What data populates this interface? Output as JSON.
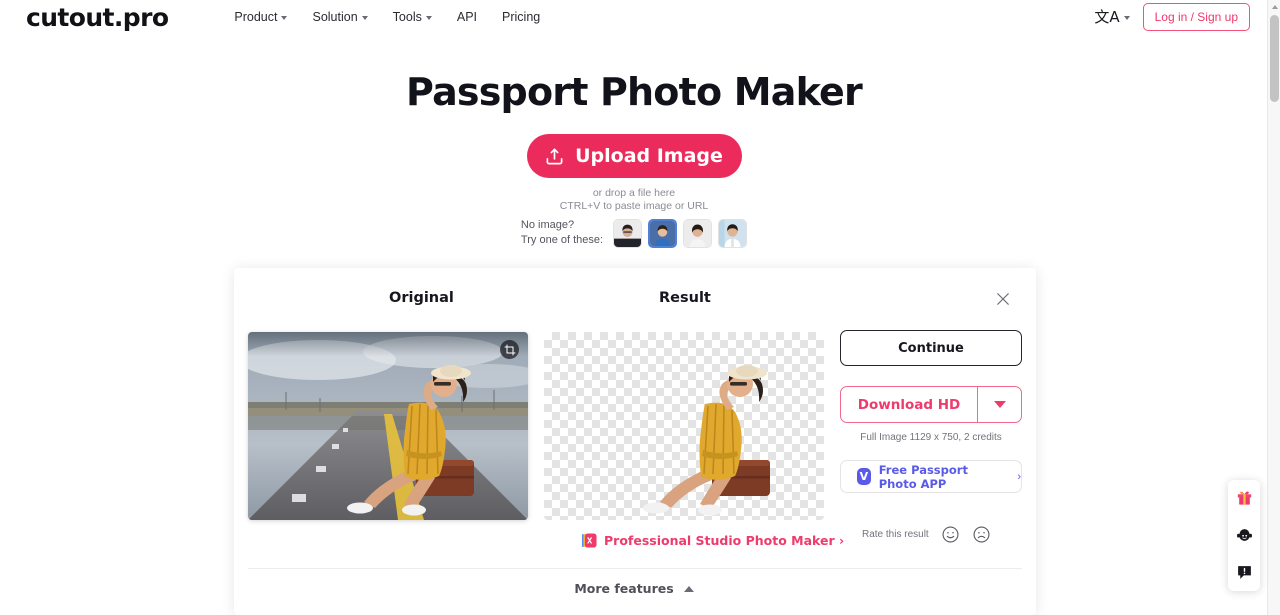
{
  "header": {
    "logo": "cutout.pro",
    "nav": [
      {
        "label": "Product",
        "has_caret": true
      },
      {
        "label": "Solution",
        "has_caret": true
      },
      {
        "label": "Tools",
        "has_caret": true
      },
      {
        "label": "API",
        "has_caret": false
      },
      {
        "label": "Pricing",
        "has_caret": false
      }
    ],
    "language_glyph": "文A",
    "login_label": "Log in / Sign up"
  },
  "hero": {
    "title": "Passport Photo Maker",
    "upload_label": "Upload Image",
    "hint_line1": "or drop a file here",
    "hint_line2": "CTRL+V to paste image or URL"
  },
  "samples": {
    "label_line1": "No image?",
    "label_line2": "Try one of these:",
    "thumbs": [
      {
        "name": "sample-1",
        "selected": false
      },
      {
        "name": "sample-2",
        "selected": true
      },
      {
        "name": "sample-3",
        "selected": false
      },
      {
        "name": "sample-4",
        "selected": false
      }
    ]
  },
  "card": {
    "original_title": "Original",
    "result_title": "Result",
    "actions": {
      "continue_label": "Continue",
      "download_label": "Download HD",
      "credits_text": "Full Image 1129 x 750, 2 credits",
      "app_label": "Free Passport Photo APP",
      "app_arrow": "›"
    },
    "promo_label": "Professional Studio Photo Maker ›",
    "rate_label": "Rate this result",
    "more_features_label": "More features"
  },
  "colors": {
    "accent_pink": "#eb2b5b",
    "accent_pink_light": "#ef3a6c",
    "app_purple": "#5a5ae8",
    "thumb_selected_border": "#4f7fd6"
  }
}
